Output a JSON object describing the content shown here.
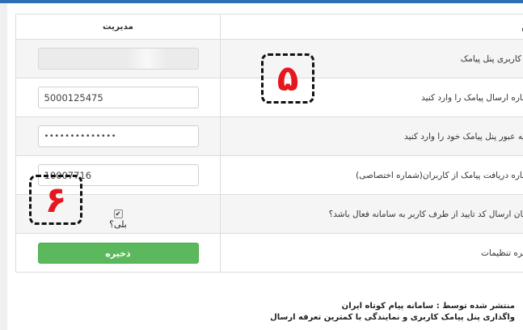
{
  "table": {
    "header_name": "نام",
    "header_management": "مدیریت"
  },
  "rows": {
    "username": {
      "label": "نام کاربری پنل پیامک",
      "value": ""
    },
    "send_number": {
      "label": "شماره ارسال پیامک را وارد کنید",
      "value": "5000125475"
    },
    "password": {
      "label": "کلمه عبور پنل پیامک خود را وارد کنید",
      "value": "••••••••••••••"
    },
    "receive_number": {
      "label": "شماره دریافت پیامک از کاربران(شماره اختصاصی)",
      "value": "10007716"
    },
    "confirm_code": {
      "label": "امکان ارسال کد تایید از طرف کاربر به سامانه فعال باشد؟",
      "checkbox_label": "بلی؟",
      "checked": true,
      "check_mark": "✔"
    },
    "save": {
      "label": "ذخیره تنظیمات",
      "button_label": "ذخیره"
    }
  },
  "annotations": {
    "callout_5": "۵",
    "callout_6": "۶"
  },
  "footer": {
    "line1": "منتشر شده توسط : سامانه پیام کوتاه ایران",
    "line2": "واگذاری پنل پیامک کاربری و نمایندگی با کمترین تعرفه ارسال"
  },
  "colors": {
    "top_bar": "#2d6fb5",
    "save_button": "#5cb85c",
    "callout_number": "#e5181f"
  }
}
